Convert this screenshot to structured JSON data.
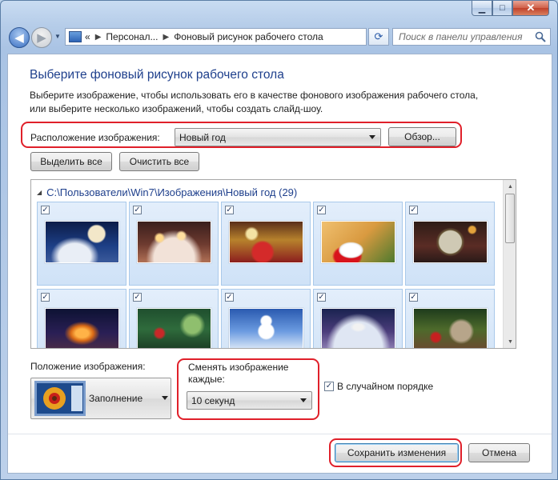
{
  "window": {
    "minimize_glyph": "▁",
    "maximize_glyph": "□",
    "close_glyph": "✕"
  },
  "nav": {
    "back_icon": "arrow-left",
    "forward_icon": "arrow-right",
    "breadcrumb_prefix": "«",
    "breadcrumbs": [
      "Персонал...",
      "Фоновый рисунок рабочего стола"
    ],
    "search_placeholder": "Поиск в панели управления"
  },
  "page": {
    "title": "Выберите фоновый рисунок рабочего стола",
    "description_line1": "Выберите изображение, чтобы использовать его в качестве фонового изображения рабочего стола,",
    "description_line2": "или выберите несколько изображений, чтобы создать слайд-шоу."
  },
  "location": {
    "label": "Расположение изображения:",
    "selected": "Новый год",
    "browse_label": "Обзор..."
  },
  "actions": {
    "select_all": "Выделить все",
    "clear_all": "Очистить все"
  },
  "gallery": {
    "header": "C:\\Пользователи\\Win7\\Изображения\\Новый год (29)",
    "checkbox_glyph": "✓",
    "tiles": [
      {
        "checked": true,
        "theme": "snow-clock-night"
      },
      {
        "checked": true,
        "theme": "candles-table"
      },
      {
        "checked": true,
        "theme": "champagne-gifts"
      },
      {
        "checked": true,
        "theme": "kitten-santa-hat"
      },
      {
        "checked": true,
        "theme": "clock-twelve"
      },
      {
        "checked": true,
        "theme": "christmas-tree-night"
      },
      {
        "checked": true,
        "theme": "green-bokeh-branch"
      },
      {
        "checked": true,
        "theme": "snowman"
      },
      {
        "checked": true,
        "theme": "winter-tree-lights"
      },
      {
        "checked": true,
        "theme": "kitten-ornaments"
      }
    ]
  },
  "position": {
    "label": "Положение изображения:",
    "selected": "Заполнение"
  },
  "interval": {
    "label": "Сменять изображение каждые:",
    "selected": "10 секунд"
  },
  "shuffle": {
    "checked": true,
    "label": "В случайном порядке"
  },
  "footer": {
    "save_label": "Сохранить изменения",
    "cancel_label": "Отмена"
  },
  "colors": {
    "highlight": "#e0202a",
    "title_blue": "#1e3f8c"
  }
}
